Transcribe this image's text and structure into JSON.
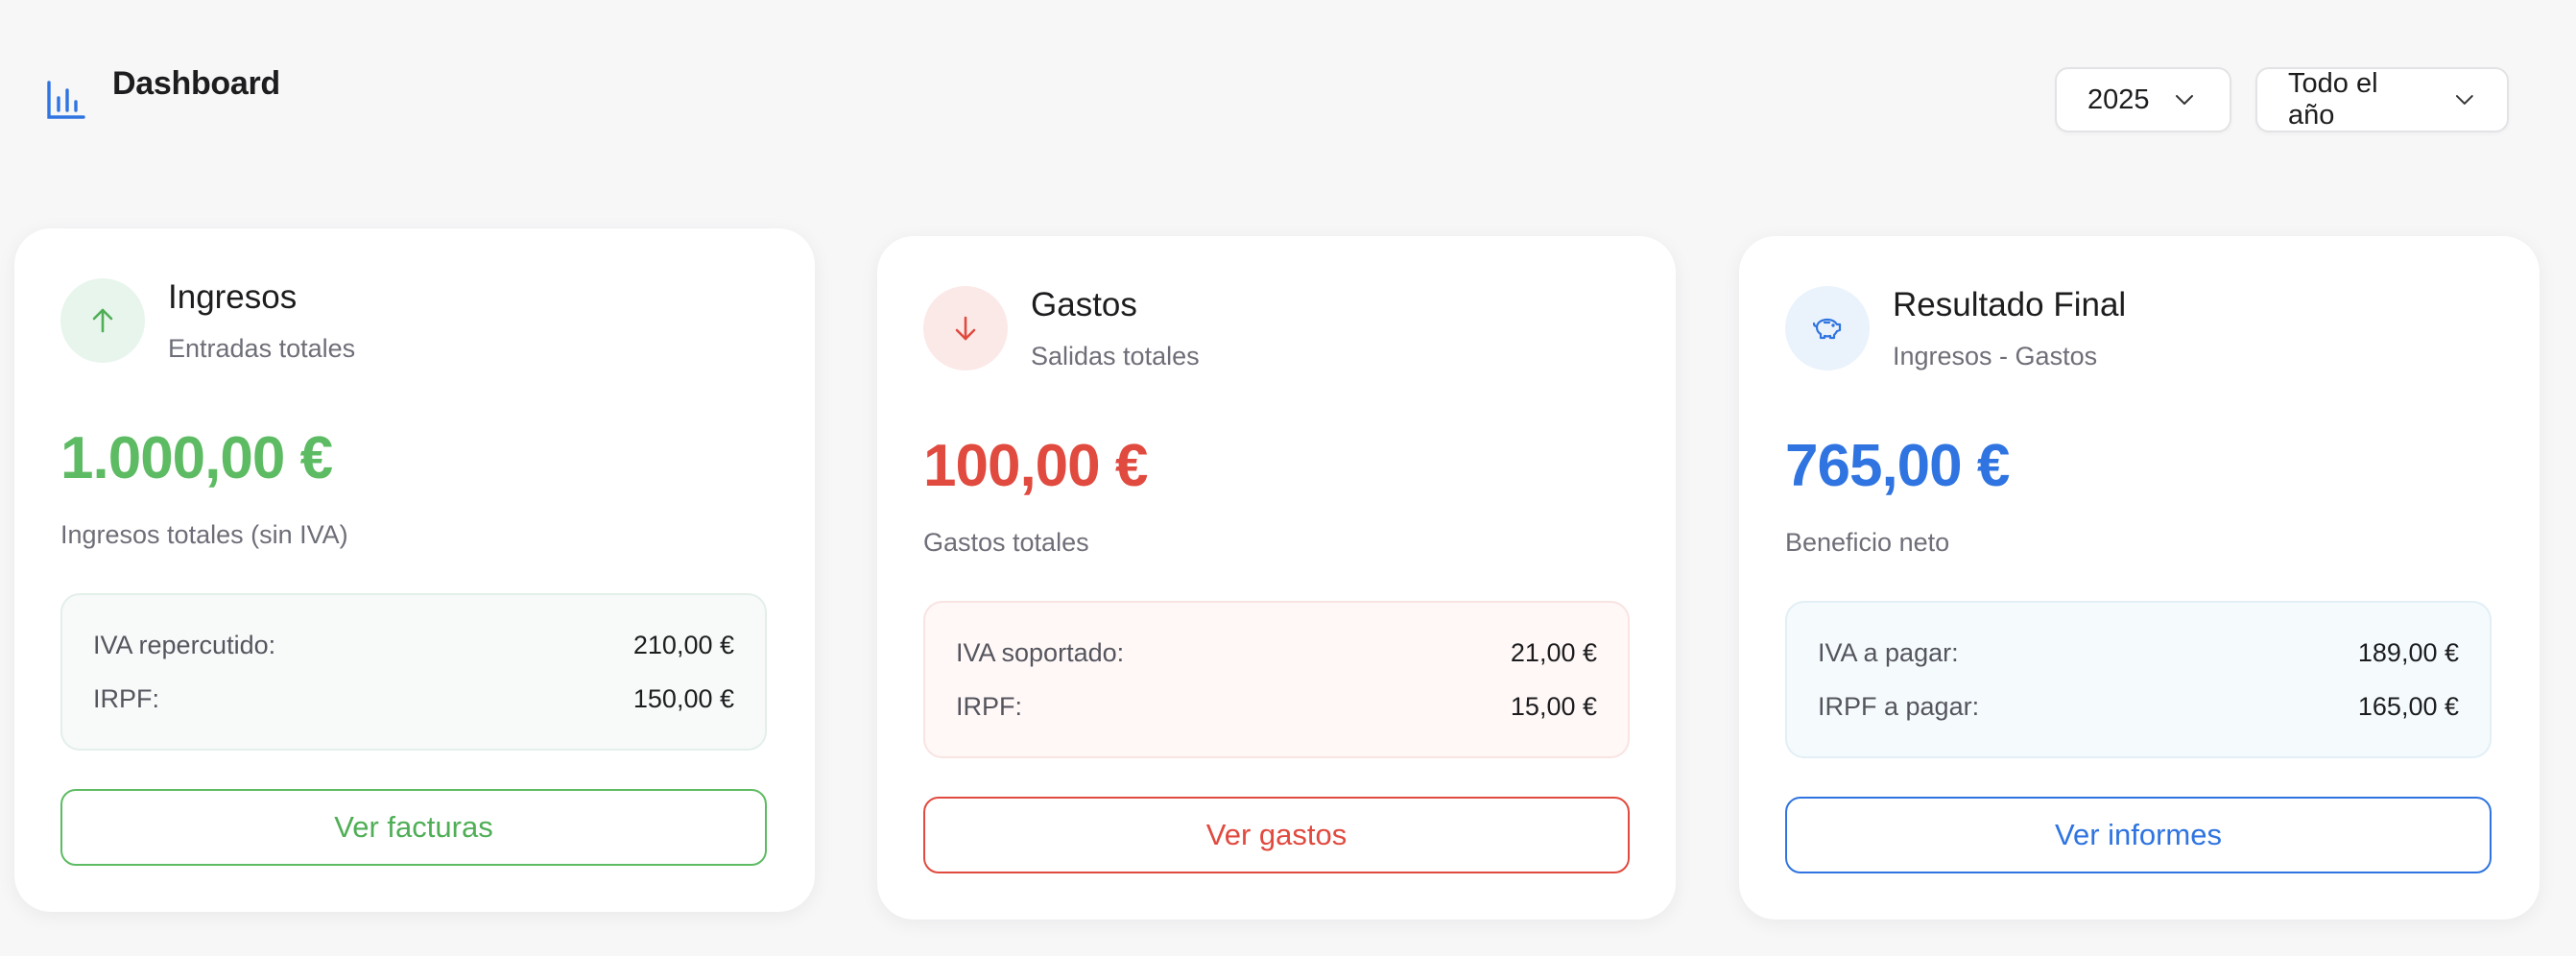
{
  "header": {
    "title": "Dashboard",
    "icon": "bar-chart-icon",
    "accent": "#2f74e0"
  },
  "filters": {
    "year": {
      "selected": "2025"
    },
    "period": {
      "selected": "Todo el año"
    }
  },
  "cards": [
    {
      "icon": "arrow-up-icon",
      "title": "Ingresos",
      "subtitle": "Entradas totales",
      "amount": "1.000,00 €",
      "amount_label": "Ingresos totales (sin IVA)",
      "color": "#5dbb63",
      "rows": [
        {
          "label": "IVA repercutido:",
          "value": "210,00 €"
        },
        {
          "label": "IRPF:",
          "value": "150,00 €"
        }
      ],
      "button": "Ver facturas"
    },
    {
      "icon": "arrow-down-icon",
      "title": "Gastos",
      "subtitle": "Salidas totales",
      "amount": "100,00 €",
      "amount_label": "Gastos totales",
      "color": "#e04a3f",
      "rows": [
        {
          "label": "IVA soportado:",
          "value": "21,00 €"
        },
        {
          "label": "IRPF:",
          "value": "15,00 €"
        }
      ],
      "button": "Ver gastos"
    },
    {
      "icon": "piggy-bank-icon",
      "title": "Resultado Final",
      "subtitle": "Ingresos - Gastos",
      "amount": "765,00 €",
      "amount_label": "Beneficio neto",
      "color": "#2f74e0",
      "rows": [
        {
          "label": "IVA a pagar:",
          "value": "189,00 €"
        },
        {
          "label": "IRPF a pagar:",
          "value": "165,00 €"
        }
      ],
      "button": "Ver informes"
    }
  ]
}
